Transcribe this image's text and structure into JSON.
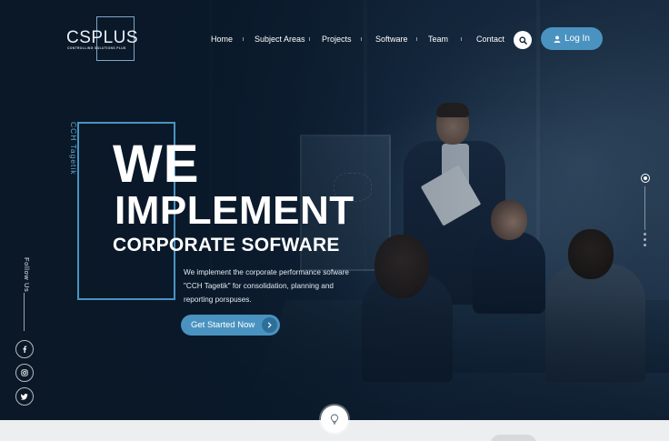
{
  "brand": {
    "name": "CSPLUS",
    "tagline": "CONTROLLING SOLUTIONS PLUS"
  },
  "nav": {
    "items": [
      "Home",
      "Subject Areas",
      "Projects",
      "Software",
      "Team",
      "Contact"
    ],
    "search_icon": "search-icon",
    "login_label": "Log In",
    "login_icon": "user-icon"
  },
  "hero": {
    "vertical_tag": "CCH Tagetik",
    "headline_1": "WE",
    "headline_2": "IMPLEMENT",
    "headline_3": "CORPORATE SOFWARE",
    "description": "We implement the corporate performance sofware \"CCH Tagetik\" for consolidation, planning and reporting porspuses.",
    "cta_label": "Get Started Now",
    "cta_icon": "chevron-right-icon"
  },
  "social": {
    "label": "Follow Us",
    "icons": [
      "facebook-icon",
      "instagram-icon",
      "twitter-icon"
    ]
  },
  "slider": {
    "active_index": 0,
    "count": 4
  },
  "scroll": {
    "icon": "lightbulb-icon"
  },
  "colors": {
    "accent": "#4a93c0",
    "background": "#0b1a2c",
    "frame": "#4a93c0",
    "text": "#ffffff"
  }
}
